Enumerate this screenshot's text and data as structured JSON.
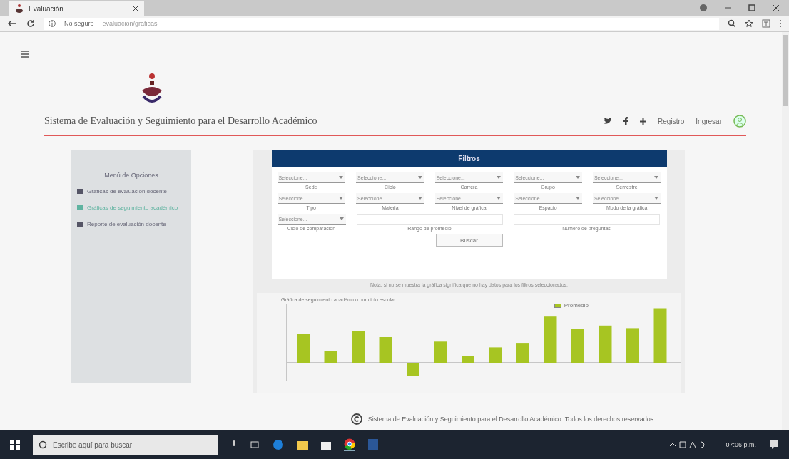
{
  "browser": {
    "tab_title": "Evaluación",
    "security": "No seguro",
    "url": "evaluacion/graficas"
  },
  "header": {
    "title": "Sistema de Evaluación y Seguimiento para el Desarrollo Académico",
    "register": "Registro",
    "login": "Ingresar"
  },
  "sidebar": {
    "title": "Menú de Opciones",
    "items": [
      {
        "label": "Gráficas de evaluación docente",
        "selected": false
      },
      {
        "label": "Gráficas de seguimiento académico",
        "selected": true
      },
      {
        "label": "Reporte de evaluación docente",
        "selected": false
      }
    ]
  },
  "filters": {
    "title": "Filtros",
    "fields": [
      {
        "kind": "select",
        "placeholder": "Seleccione...",
        "label": "Sede"
      },
      {
        "kind": "select",
        "placeholder": "Seleccione...",
        "label": "Ciclo"
      },
      {
        "kind": "select",
        "placeholder": "Seleccione...",
        "label": "Carrera"
      },
      {
        "kind": "select",
        "placeholder": "Seleccione...",
        "label": "Grupo"
      },
      {
        "kind": "select",
        "placeholder": "Seleccione...",
        "label": "Semestre"
      },
      {
        "kind": "select",
        "placeholder": "Seleccione...",
        "label": "Tipo"
      },
      {
        "kind": "select",
        "placeholder": "Seleccione...",
        "label": "Materia"
      },
      {
        "kind": "select",
        "placeholder": "Seleccione...",
        "label": "Nivel de gráfica"
      },
      {
        "kind": "select",
        "placeholder": "Seleccione...",
        "label": "Espacio"
      },
      {
        "kind": "select",
        "placeholder": "Seleccione...",
        "label": "Modo de la gráfica"
      },
      {
        "kind": "select",
        "placeholder": "Seleccione...",
        "label": "Ciclo de comparación"
      },
      {
        "kind": "text",
        "label": "Rango de promedio"
      },
      {
        "kind": "text",
        "label": "Número de preguntas"
      }
    ],
    "button": "Buscar",
    "note": "Nota: si no se muestra la gráfica significa que no hay datos para los filtros seleccionados."
  },
  "chart": {
    "title": "Gráfica de seguimiento académico por ciclo escolar",
    "legend": "Promedio"
  },
  "footer": "Sistema de Evaluación y Seguimiento para el Desarrollo Académico. Todos los derechos reservados",
  "taskbar": {
    "search_placeholder": "Escribe aquí para buscar",
    "time": "07:06 p.m."
  }
}
